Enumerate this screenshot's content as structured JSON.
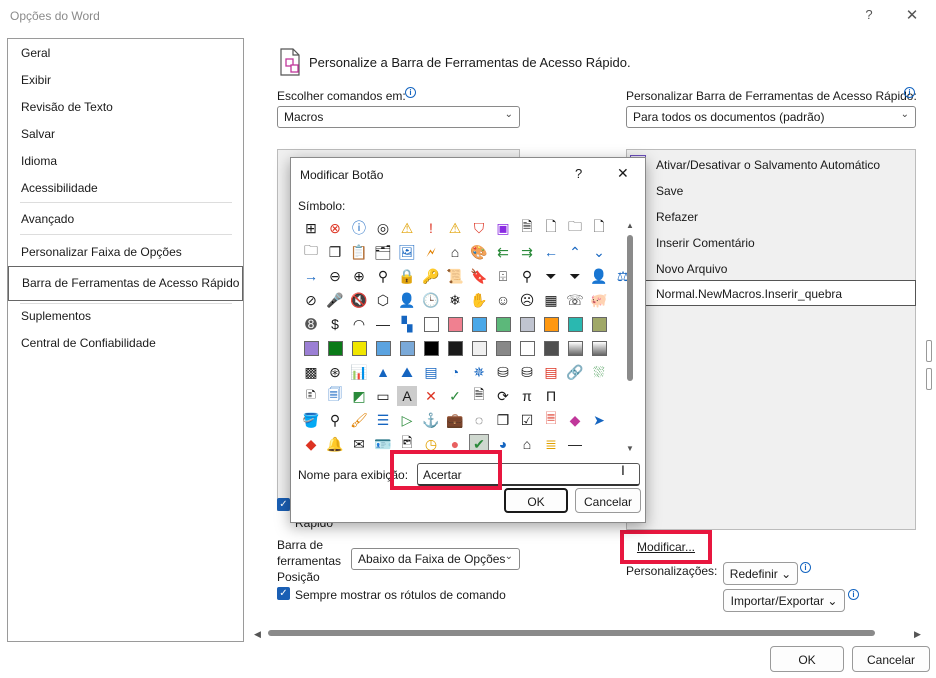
{
  "window": {
    "title": "Opções do Word",
    "help": "?",
    "close": "✕"
  },
  "sidebar": {
    "items": [
      {
        "label": "Geral"
      },
      {
        "label": "Exibir"
      },
      {
        "label": "Revisão de Texto"
      },
      {
        "label": "Salvar"
      },
      {
        "label": "Idioma"
      },
      {
        "label": "Acessibilidade"
      },
      {
        "label": "Avançado"
      },
      {
        "label": "Personalizar Faixa de Opções"
      },
      {
        "label": "Barra de Ferramentas de Acesso Rápido"
      },
      {
        "label": "Suplementos"
      },
      {
        "label": "Central de Confiabilidade"
      }
    ],
    "selected_index": 8
  },
  "main": {
    "header": "Personalize a Barra de Ferramentas de Acesso Rápido.",
    "choose_label": "Escolher comandos em:",
    "choose_value": "Macros",
    "customize_label": "Personalizar Barra de Ferramentas de Acesso Rápido:",
    "customize_value": "Para todos os documentos (padrão)",
    "qat_items": [
      {
        "label": "Ativar/Desativar o Salvamento Automático"
      },
      {
        "label": "Save"
      },
      {
        "label": "Refazer"
      },
      {
        "label": "Inserir Comentário"
      },
      {
        "label": "Novo Arquivo"
      },
      {
        "label": "Normal.NewMacros.Inserir_quebra"
      }
    ],
    "show_qat_label_partial": "Rápido",
    "toolbar_pos_label_1": "Barra de",
    "toolbar_pos_label_2": "ferramentas",
    "toolbar_pos_label_3": "Posição",
    "toolbar_pos_value": "Abaixo da Faixa de Opções",
    "always_show_labels": "Sempre mostrar os rótulos de comando",
    "modify_button": "Modificar...",
    "customizations_label": "Personalizações:",
    "reset_button": "Redefinir",
    "import_export_button": "Importar/Exportar"
  },
  "footer": {
    "ok": "OK",
    "cancel": "Cancelar"
  },
  "dialog": {
    "title": "Modificar Botão",
    "help": "?",
    "close": "✕",
    "symbol_label": "Símbolo:",
    "display_name_label": "Nome para exibição:",
    "display_name_value": "Acertar",
    "ok": "OK",
    "cancel": "Cancelar",
    "swatch_colors": [
      "#9b7fd4",
      "#0a7a18",
      "#f0e600",
      "#5ba3e0",
      "#7aa9d8",
      "#000000",
      "#1a1a1a",
      "#f0f0f0",
      "#888888",
      "#ffffff",
      "#505050"
    ],
    "row5_colors": [
      "#777777",
      "#ffffff",
      "#f08090",
      "#4aa8e8",
      "#5cb87a",
      "#c0c4d0",
      "#ff9810",
      "#2ab8b0",
      "#a0a868"
    ]
  }
}
